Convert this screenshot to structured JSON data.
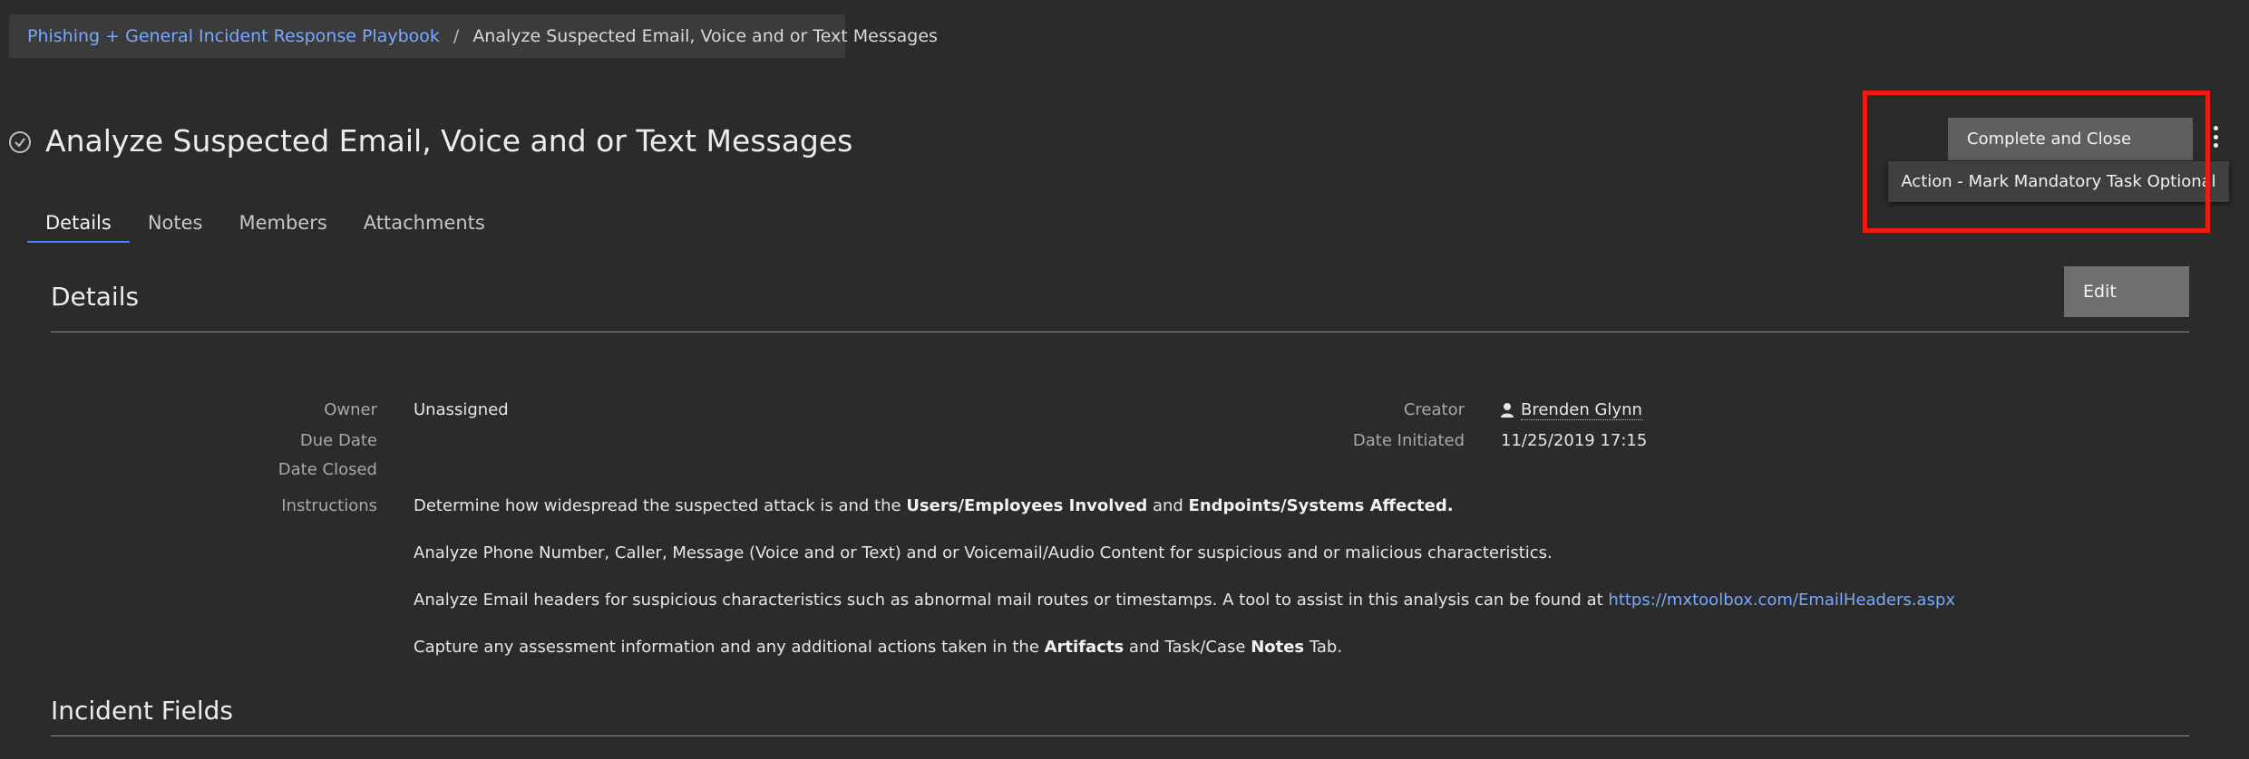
{
  "breadcrumb": {
    "parent": "Phishing + General Incident Response Playbook",
    "separator": "/",
    "current": "Analyze Suspected Email, Voice and or Text Messages"
  },
  "page": {
    "title": "Analyze Suspected Email, Voice and or Text Messages",
    "status_icon": "check-circle-icon"
  },
  "tabs": [
    {
      "label": "Details",
      "active": true
    },
    {
      "label": "Notes",
      "active": false
    },
    {
      "label": "Members",
      "active": false
    },
    {
      "label": "Attachments",
      "active": false
    }
  ],
  "actions": {
    "complete_label": "Complete and Close",
    "menu_icon": "kebab-icon",
    "menu_item": "Action - Mark Mandatory Task Optional",
    "highlight_color": "#f01a14"
  },
  "details": {
    "title": "Details",
    "edit_label": "Edit",
    "owner_label": "Owner",
    "owner_value": "Unassigned",
    "due_date_label": "Due Date",
    "due_date_value": "",
    "date_closed_label": "Date Closed",
    "date_closed_value": "",
    "creator_label": "Creator",
    "creator_value": "Brenden Glynn",
    "date_initiated_label": "Date Initiated",
    "date_initiated_value": "11/25/2019 17:15",
    "instructions_label": "Instructions",
    "instructions": {
      "p1_a": "Determine how widespread the suspected attack is and the ",
      "p1_b": "Users/Employees Involved",
      "p1_c": " and ",
      "p1_d": "Endpoints/Systems Affected.",
      "p2": "Analyze Phone Number, Caller, Message (Voice and or Text) and or Voicemail/Audio Content for suspicious and or malicious characteristics.",
      "p3_a": "Analyze Email headers for suspicious characteristics such as abnormal mail routes or timestamps. A tool to assist in this analysis can be found at ",
      "p3_link": "https://mxtoolbox.com/EmailHeaders.aspx",
      "p4_a": "Capture any assessment information and any additional actions taken in the ",
      "p4_b": "Artifacts",
      "p4_c": " and Task/Case ",
      "p4_d": "Notes",
      "p4_e": " Tab."
    }
  },
  "incident_fields": {
    "title": "Incident Fields"
  },
  "colors": {
    "background": "#2b2b2b",
    "link": "#78a9ff",
    "active_tab": "#4589ff"
  }
}
